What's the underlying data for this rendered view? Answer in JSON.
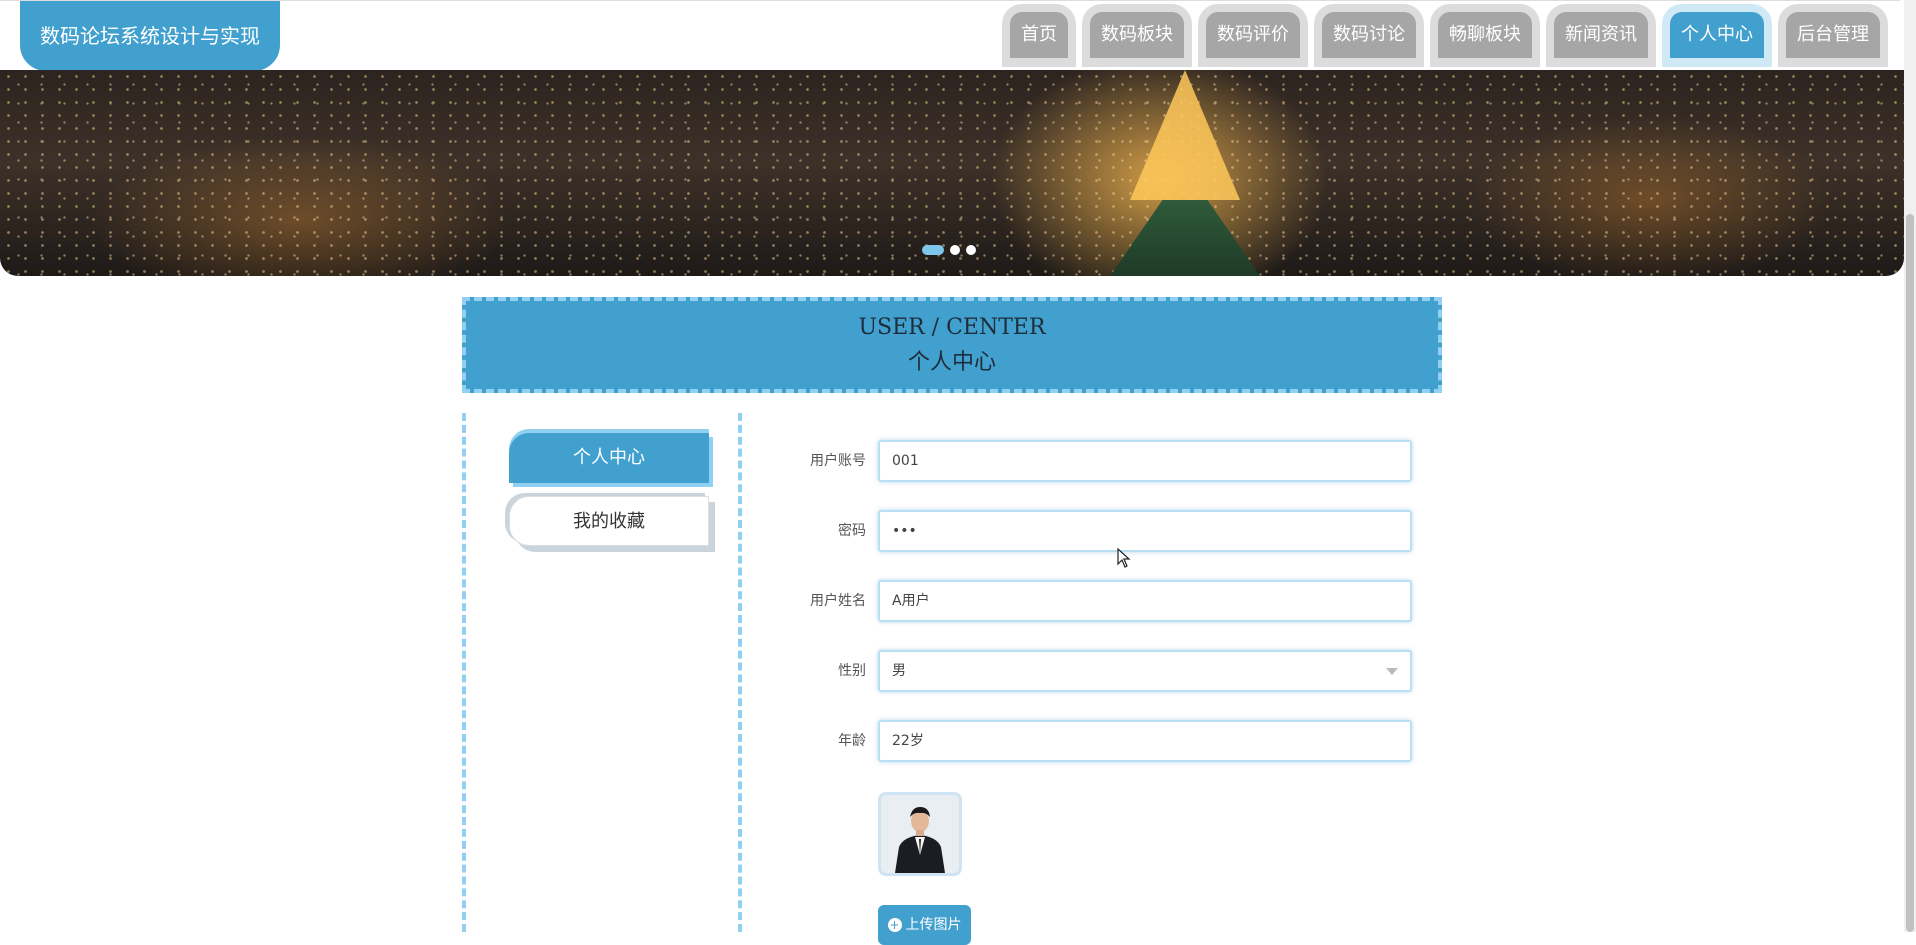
{
  "app": {
    "title": "数码论坛系统设计与实现"
  },
  "nav": [
    {
      "label": "首页"
    },
    {
      "label": "数码板块"
    },
    {
      "label": "数码评价"
    },
    {
      "label": "数码讨论"
    },
    {
      "label": "畅聊板块"
    },
    {
      "label": "新闻资讯"
    },
    {
      "label": "个人中心",
      "active": true
    },
    {
      "label": "后台管理"
    }
  ],
  "banner": {
    "slide_count": 3,
    "active_slide": 1
  },
  "section": {
    "title_en": "USER / CENTER",
    "title_cn": "个人中心"
  },
  "sidebar": [
    {
      "label": "个人中心",
      "active": true
    },
    {
      "label": "我的收藏"
    }
  ],
  "form": {
    "fields": [
      {
        "label": "用户账号",
        "value": "001"
      },
      {
        "label": "密码",
        "value": "•••"
      },
      {
        "label": "用户姓名",
        "value": "A用户"
      },
      {
        "label": "性别",
        "value": "男"
      },
      {
        "label": "年龄",
        "value": "22岁"
      }
    ],
    "upload_label": "上传图片"
  },
  "colors": {
    "accent": "#42a0cf",
    "accent_light": "#8fd0f3",
    "nav_inactive": "#a6a6a6"
  },
  "icons": {
    "upload": "plus-circle-icon",
    "select": "chevron-down-icon"
  }
}
